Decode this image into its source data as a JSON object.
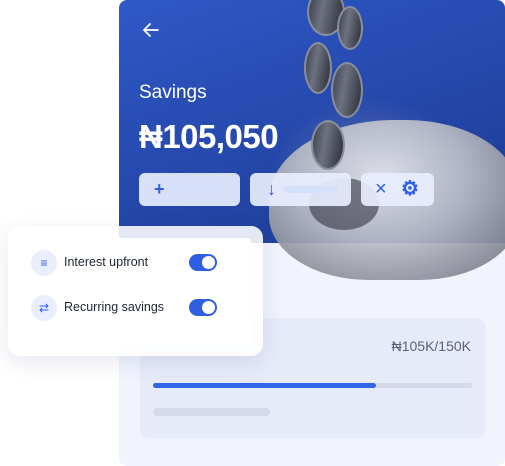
{
  "savings": {
    "title": "Savings",
    "balance": "₦105,050",
    "progress": {
      "label": "₦105K/150K",
      "fraction": 0.7
    }
  },
  "actions": [
    {
      "icon": "plus-icon",
      "glyph": "+"
    },
    {
      "icon": "arrow-down-icon",
      "glyph": "↓"
    },
    {
      "icon": "close-icon",
      "glyph": "×"
    },
    {
      "icon": "gear-icon",
      "glyph": "⚙"
    }
  ],
  "settings": {
    "items": [
      {
        "label": "Interest upfront",
        "icon": "coins-icon",
        "enabled": true
      },
      {
        "label": "Recurring savings",
        "icon": "recurring-icon",
        "enabled": true
      }
    ]
  },
  "colors": {
    "accent": "#2f5fe0",
    "hero": "#2447aa",
    "panel": "#f1f4fd"
  }
}
